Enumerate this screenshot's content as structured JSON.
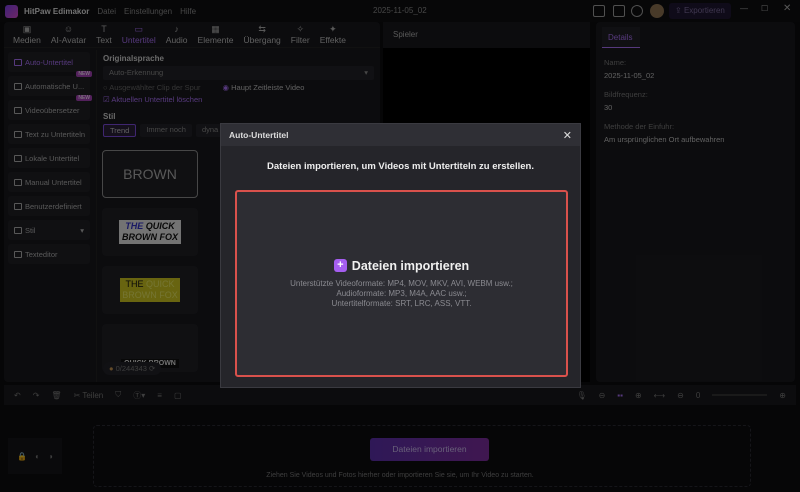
{
  "app": {
    "name": "HitPaw Edimakor",
    "menu": [
      "Datei",
      "Einstellungen",
      "Hilfe"
    ],
    "project": "2025-11-05_02",
    "export": "Exportieren"
  },
  "tabs": [
    "Medien",
    "AI-Avatar",
    "Text",
    "Untertitel",
    "Audio",
    "Elemente",
    "Übergang",
    "Filter",
    "Effekte"
  ],
  "tab_icons": [
    "image-icon",
    "avatar-icon",
    "text-icon",
    "subtitle-icon",
    "music-icon",
    "elements-icon",
    "transition-icon",
    "filter-icon",
    "effects-icon"
  ],
  "sidebar": [
    {
      "label": "Auto-Untertitel"
    },
    {
      "label": "Automatische U...",
      "badge": "NEW"
    },
    {
      "label": "Videoübersetzer",
      "badge": "NEW"
    },
    {
      "label": "Text zu Untertiteln"
    },
    {
      "label": "Lokale Untertitel"
    },
    {
      "label": "Manual Untertitel"
    },
    {
      "label": "Benutzerdefiniert"
    },
    {
      "label": "Stil"
    },
    {
      "label": "Texteditor"
    }
  ],
  "content": {
    "orig_label": "Originalsprache",
    "orig_value": "Auto-Erkennung",
    "radio1": "Ausgewählter Clip der Spur",
    "radio2": "Haupt Zeitleiste Video",
    "checkbox": "Aktuellen Untertitel löschen",
    "stil_label": "Stil",
    "stil_tabs": [
      "Trend",
      "Immer noch",
      "dyna"
    ],
    "card1": "BROWN",
    "card2a": "THE",
    "card2b": "QUICK",
    "card2c": "BROWN FOX",
    "card3a": "THE",
    "card3b": "QUICK",
    "card3c": "BROWN FOX",
    "card4": "QUICK BROWN",
    "credits": "0/244343"
  },
  "player": {
    "title": "Spieler"
  },
  "details": {
    "tab": "Details",
    "name_label": "Name:",
    "name": "2025-11-05_02",
    "fps_label": "Bildfrequenz:",
    "fps": "30",
    "method_label": "Methode der Einfuhr:",
    "method": "Am ursprünglichen Ort aufbewahren"
  },
  "timeline": {
    "split": "Teilen",
    "zoom": "0",
    "import": "Dateien importieren",
    "hint": "Ziehen Sie Videos und Fotos hierher oder importieren Sie sie, um Ihr Video zu starten."
  },
  "modal": {
    "title": "Auto-Untertitel",
    "heading": "Dateien importieren, um Videos mit Untertiteln zu erstellen.",
    "button": "Dateien importieren",
    "formats": [
      "Unterstützte Videoformate: MP4, MOV, MKV, AVI, WEBM usw.;",
      "Audioformate: MP3, M4A, AAC usw.;",
      "Untertitelformate: SRT, LRC, ASS, VTT."
    ]
  },
  "colors": {
    "accent": "#a66ef0",
    "highlight_border": "#d9514c"
  }
}
